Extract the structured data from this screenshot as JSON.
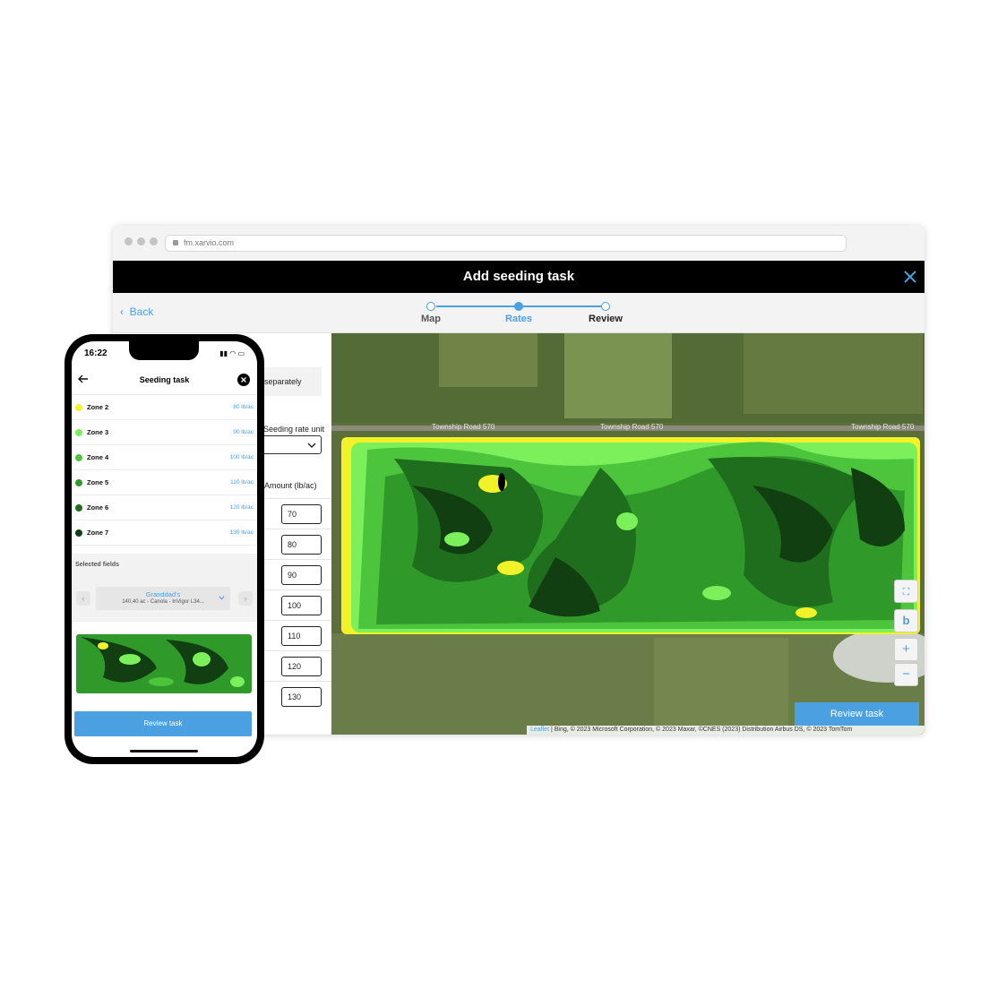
{
  "browser": {
    "url": "fm.xarvio.com"
  },
  "app": {
    "title": "Add seeding task",
    "back_label": "Back",
    "steps": [
      {
        "label": "Map",
        "state": "done"
      },
      {
        "label": "Rates",
        "state": "active"
      },
      {
        "label": "Review",
        "state": "upcoming"
      }
    ]
  },
  "rates_panel": {
    "separately_label": "separately",
    "rate_unit_label": "Seeding rate unit",
    "amount_header": "Amount (lb/ac)",
    "amounts": [
      "70",
      "80",
      "90",
      "100",
      "110",
      "120",
      "130"
    ]
  },
  "map": {
    "road_labels": [
      "Township Road 570",
      "Township Road 570",
      "Township Road 570"
    ],
    "controls": {
      "zoom_in": "+",
      "zoom_out": "−"
    },
    "review_button": "Review task",
    "attribution_leaflet": "Leaflet",
    "attribution_rest": " | Bing, © 2023 Microsoft Corporation, © 2023 Maxar, ©CNES (2023) Distribution Airbus DS, © 2023 TomTom"
  },
  "phone": {
    "time": "16:22",
    "title": "Seeding task",
    "zones": [
      {
        "name": "Zone 2",
        "rate": "80 lb/ac",
        "color": "#f2f229"
      },
      {
        "name": "Zone 3",
        "rate": "90 lb/ac",
        "color": "#7cf05a"
      },
      {
        "name": "Zone 4",
        "rate": "100 lb/ac",
        "color": "#4cc43c"
      },
      {
        "name": "Zone 5",
        "rate": "110 lb/ac",
        "color": "#2f9a2a"
      },
      {
        "name": "Zone 6",
        "rate": "120 lb/ac",
        "color": "#1f6e1d"
      },
      {
        "name": "Zone 7",
        "rate": "130 lb/ac",
        "color": "#123f12"
      }
    ],
    "selected_fields_label": "Selected fields",
    "field_name": "Granddad's",
    "field_desc": "140,40 ac - Canola - InVigor L34...",
    "review_button": "Review task"
  }
}
